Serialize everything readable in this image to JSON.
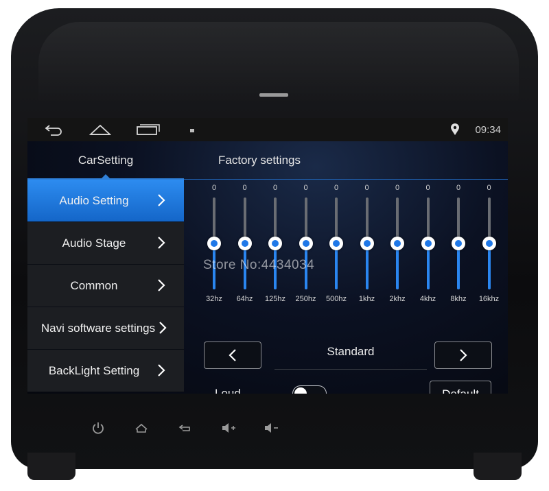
{
  "statusbar": {
    "time": "09:34",
    "icons": [
      "back-icon",
      "home-icon",
      "recent-apps-icon",
      "notification-icon",
      "location-pin-icon"
    ]
  },
  "sidebar": {
    "title": "CarSetting",
    "items": [
      {
        "label": "Audio Setting",
        "active": true
      },
      {
        "label": "Audio Stage",
        "active": false
      },
      {
        "label": "Common",
        "active": false
      },
      {
        "label": "Navi software settings",
        "active": false
      },
      {
        "label": "BackLight Setting",
        "active": false
      }
    ]
  },
  "content": {
    "title": "Factory settings",
    "equalizer": {
      "bands": [
        {
          "freq": "32hz",
          "value": "0",
          "level": 0.5
        },
        {
          "freq": "64hz",
          "value": "0",
          "level": 0.5
        },
        {
          "freq": "125hz",
          "value": "0",
          "level": 0.5
        },
        {
          "freq": "250hz",
          "value": "0",
          "level": 0.5
        },
        {
          "freq": "500hz",
          "value": "0",
          "level": 0.5
        },
        {
          "freq": "1khz",
          "value": "0",
          "level": 0.5
        },
        {
          "freq": "2khz",
          "value": "0",
          "level": 0.5
        },
        {
          "freq": "4khz",
          "value": "0",
          "level": 0.5
        },
        {
          "freq": "8khz",
          "value": "0",
          "level": 0.5
        },
        {
          "freq": "16khz",
          "value": "0",
          "level": 0.5
        }
      ]
    },
    "preset": {
      "label": "Standard"
    },
    "loud": {
      "label": "Loud",
      "on": false
    },
    "default_label": "Default"
  },
  "watermark": "Store No:4434034",
  "hardware_buttons": [
    "power-icon",
    "home-icon",
    "back-icon",
    "volume-up-icon",
    "volume-down-icon"
  ],
  "colors": {
    "accent": "#2d8cf0",
    "sidebar_bg": "#1c1e22",
    "slider_fill": "#2a86f0"
  }
}
